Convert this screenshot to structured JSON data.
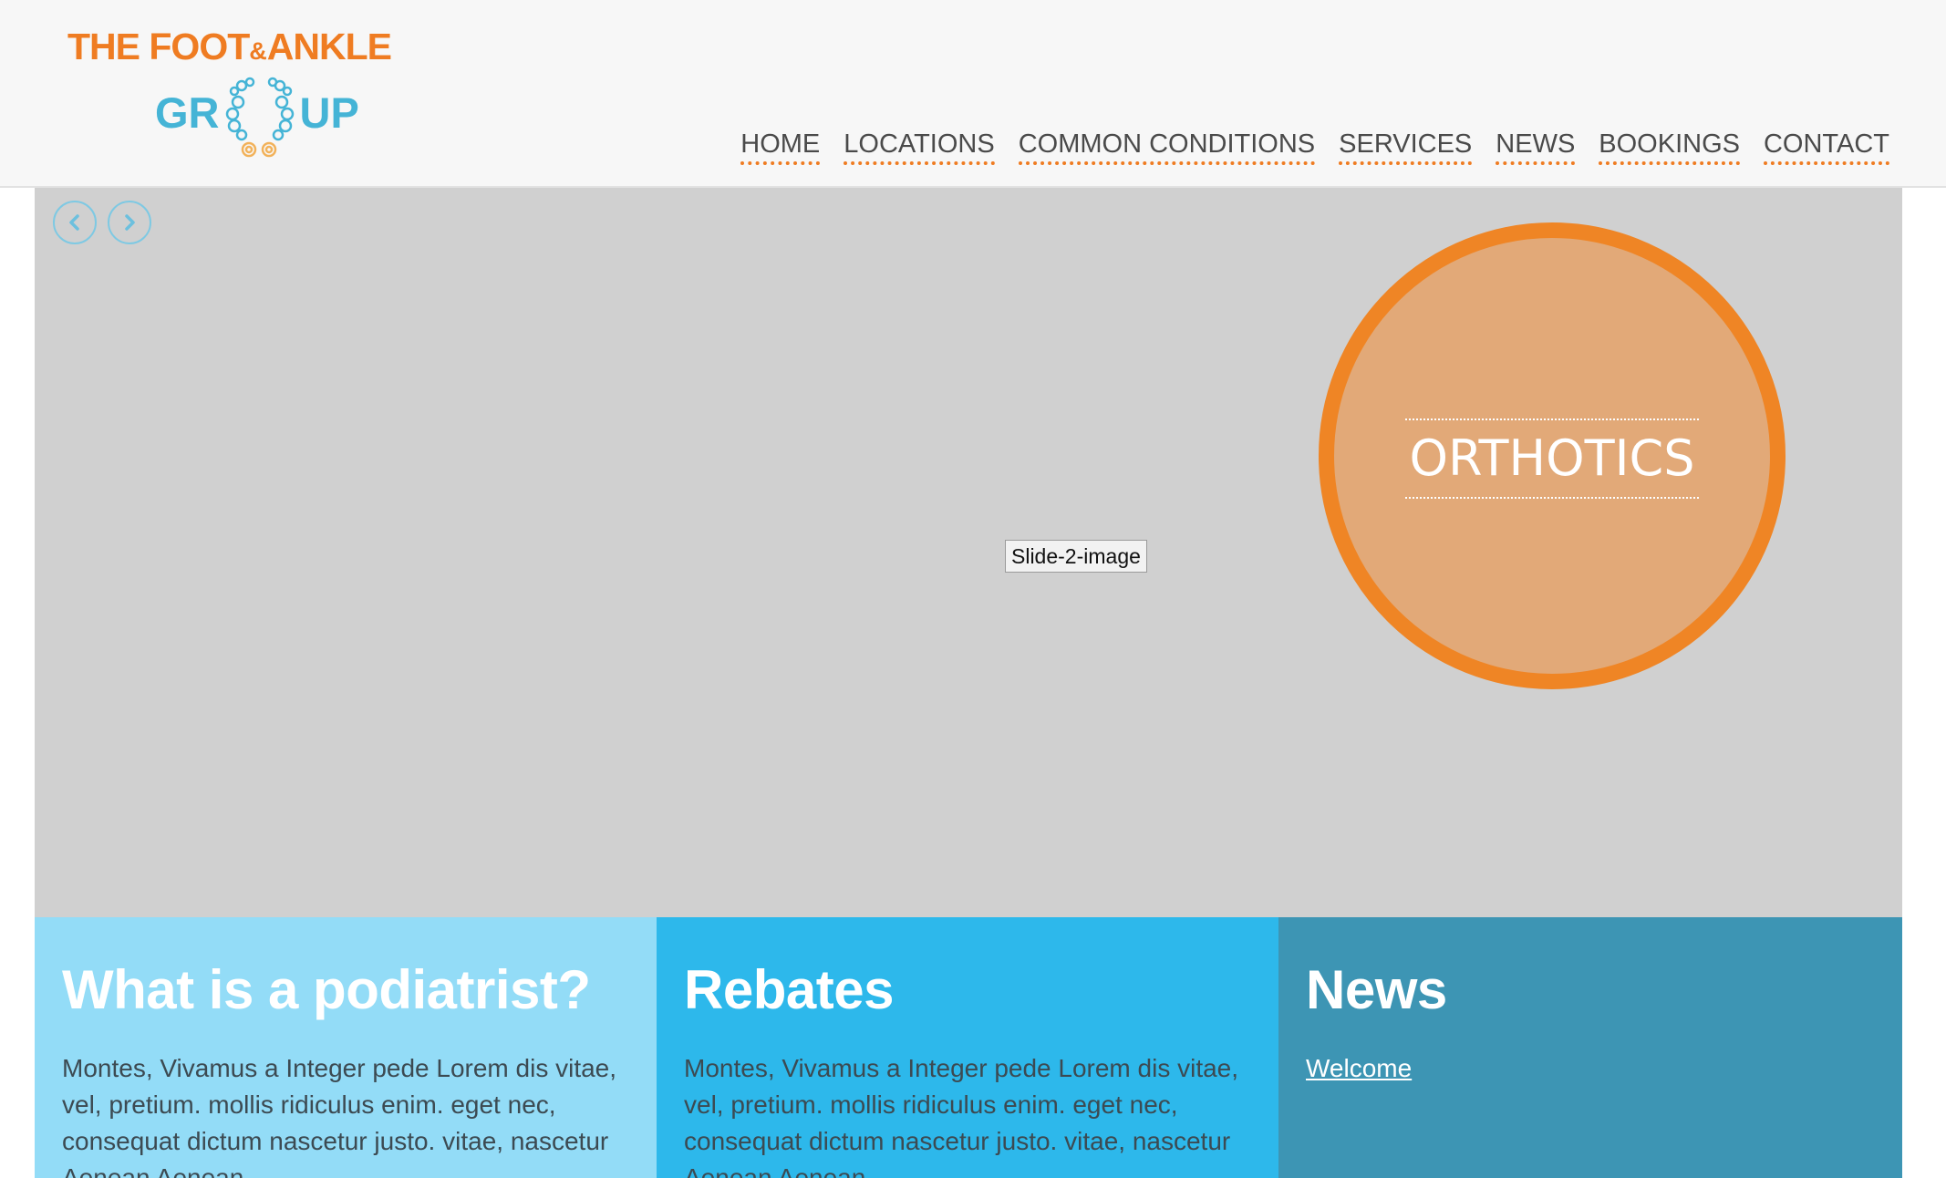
{
  "header": {
    "logo": {
      "line1_main": "THE FOOT",
      "line1_amp": "&",
      "line1_end": "ANKLE",
      "line2_start": "GR",
      "line2_end": "UP",
      "brand_orange": "#ef7c22",
      "brand_blue": "#45b4d6"
    },
    "nav": [
      {
        "label": "HOME"
      },
      {
        "label": "LOCATIONS"
      },
      {
        "label": "COMMON CONDITIONS"
      },
      {
        "label": "SERVICES"
      },
      {
        "label": "NEWS"
      },
      {
        "label": "BOOKINGS"
      },
      {
        "label": "CONTACT"
      }
    ]
  },
  "slider": {
    "prev_icon": "chevron-left-icon",
    "next_icon": "chevron-right-icon",
    "image_alt": "Slide-2-image",
    "caption": "ORTHOTICS",
    "circle_color": "#e2a978",
    "circle_border": "#ef8525"
  },
  "features": [
    {
      "title": "What is a podiatrist?",
      "text": "Montes, Vivamus a Integer pede Lorem dis vitae, vel, pretium. mollis ridiculus enim. eget nec, consequat dictum nascetur justo. vitae, nascetur Aenean Aenean",
      "color": "#93dcf7"
    },
    {
      "title": "Rebates",
      "text": "Montes, Vivamus a Integer pede Lorem dis vitae, vel, pretium. mollis ridiculus enim. eget nec, consequat dictum nascetur justo. vitae, nascetur Aenean Aenean",
      "color": "#2db8eb"
    },
    {
      "title": "News",
      "link": "Welcome",
      "color": "#3d95b4"
    }
  ]
}
